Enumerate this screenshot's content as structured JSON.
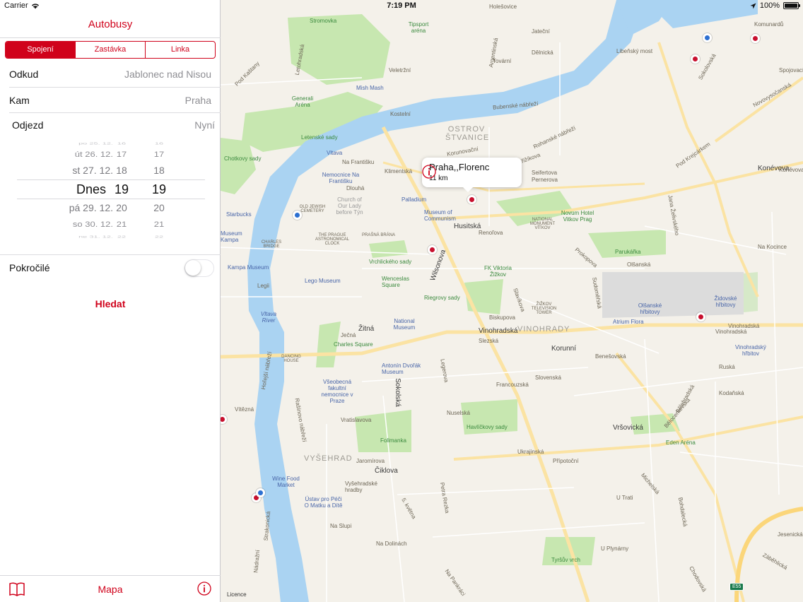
{
  "status": {
    "carrier": "Carrier",
    "time": "7:19 PM",
    "battery": "100%"
  },
  "sidebar": {
    "title": "Autobusy",
    "segments": [
      "Spojení",
      "Zastávka",
      "Linka"
    ],
    "from": {
      "label": "Odkud",
      "value": "Jablonec nad Nisou"
    },
    "to": {
      "label": "Kam",
      "value": "Praha"
    },
    "departure": {
      "label": "Odjezd",
      "value": "Nyní"
    },
    "picker": [
      {
        "day": "po 25. 12.",
        "hour": "16",
        "minute": "16"
      },
      {
        "day": "út 26. 12.",
        "hour": "17",
        "minute": "17"
      },
      {
        "day": "st 27. 12.",
        "hour": "18",
        "minute": "18"
      },
      {
        "day": "Dnes",
        "hour": "19",
        "minute": "19"
      },
      {
        "day": "pá 29. 12.",
        "hour": "20",
        "minute": "20"
      },
      {
        "day": "so 30. 12.",
        "hour": "21",
        "minute": "21"
      },
      {
        "day": "ne 31. 12.",
        "hour": "22",
        "minute": "22"
      }
    ],
    "advanced": {
      "label": "Pokročilé",
      "on": false
    },
    "search_label": "Hledat",
    "tabbar": {
      "left_icon": "book-icon",
      "center": "Mapa",
      "right_icon": "info-icon"
    }
  },
  "map": {
    "callout": {
      "title": "Praha,,Florenc",
      "subtitle": "11 km"
    },
    "legal": "Licence",
    "shield": "E55",
    "labels": [
      {
        "t": "Stromovka",
        "c": "park"
      },
      {
        "t": "Tipsport aréna",
        "c": "park"
      },
      {
        "t": "Generali Aréna",
        "c": "park"
      },
      {
        "t": "Letenské sady",
        "c": "park"
      },
      {
        "t": "Mish Mash",
        "c": "poi"
      },
      {
        "t": "Chotkovy sady",
        "c": "park"
      },
      {
        "t": "Nemocnice Na Františku",
        "c": "poi"
      },
      {
        "t": "Palladium",
        "c": "poi"
      },
      {
        "t": "Museum of Communism",
        "c": "poi"
      },
      {
        "t": "OLD JEWISH CEMETERY",
        "c": ""
      },
      {
        "t": "Church of Our Lady before Týn",
        "c": ""
      },
      {
        "t": "THE PRAGUE ASTRONOMICAL CLOCK",
        "c": ""
      },
      {
        "t": "PRAŠNÁ BRÁNA",
        "c": ""
      },
      {
        "t": "CHARLES BRIDGE",
        "c": ""
      },
      {
        "t": "Starbucks",
        "c": "poi"
      },
      {
        "t": "Museum Kampa",
        "c": "poi"
      },
      {
        "t": "Kampa Museum",
        "c": "poi"
      },
      {
        "t": "Lego Museum",
        "c": "poi"
      },
      {
        "t": "Vrchlického sady",
        "c": "park"
      },
      {
        "t": "Wenceslas Square",
        "c": "park"
      },
      {
        "t": "NATIONAL MONUMENT VÍTKOV",
        "c": ""
      },
      {
        "t": "Novum Hotel Vitkov Prag",
        "c": "park"
      },
      {
        "t": "Parukářka",
        "c": "park"
      },
      {
        "t": "FK Viktoria Žižkov",
        "c": "park"
      },
      {
        "t": "Riegrovy sady",
        "c": "park"
      },
      {
        "t": "ŽIŽKOV TELEVISION TOWER",
        "c": ""
      },
      {
        "t": "Olšanské hřbitovy",
        "c": "poi"
      },
      {
        "t": "Židovské hřbitovy",
        "c": "poi"
      },
      {
        "t": "Atrium Flora",
        "c": "poi"
      },
      {
        "t": "National Museum",
        "c": "poi"
      },
      {
        "t": "Charles Square",
        "c": "park"
      },
      {
        "t": "DANCING HOUSE",
        "c": ""
      },
      {
        "t": "Antonín Dvořák Museum",
        "c": "poi"
      },
      {
        "t": "Všeobecná fakultní nemocnice v Praze",
        "c": "poi"
      },
      {
        "t": "Vinohradský hřbitov",
        "c": "poi"
      },
      {
        "t": "Havlíčkovy sady",
        "c": "park"
      },
      {
        "t": "Folimanka",
        "c": "park"
      },
      {
        "t": "Eden Aréna",
        "c": "park"
      },
      {
        "t": "Vyšehradské hradby",
        "c": ""
      },
      {
        "t": "Wine Food Market",
        "c": "poi"
      },
      {
        "t": "Ústav pro Péči O Matku a Dítě",
        "c": "poi"
      },
      {
        "t": "Tyršův vrch",
        "c": "park"
      },
      {
        "t": "OSTROV ŠTVANICE",
        "c": "dist"
      },
      {
        "t": "VINOHRADY",
        "c": "dist"
      },
      {
        "t": "VYŠEHRAD",
        "c": "dist"
      },
      {
        "t": "Vltava",
        "c": "poi"
      },
      {
        "t": "Vinohradská",
        "c": "big"
      },
      {
        "t": "Žitná",
        "c": "big"
      },
      {
        "t": "Korunní",
        "c": "big"
      },
      {
        "t": "Vršovická",
        "c": "big"
      },
      {
        "t": "Husitská",
        "c": "big"
      },
      {
        "t": "Wilsonova",
        "c": "big"
      },
      {
        "t": "Sokolská",
        "c": "big"
      },
      {
        "t": "Libeňský most",
        "c": "big"
      },
      {
        "t": "Holešovice",
        "c": ""
      },
      {
        "t": "Argentinská",
        "c": ""
      },
      {
        "t": "Dělnická",
        "c": ""
      },
      {
        "t": "Tovární",
        "c": ""
      },
      {
        "t": "Veletržní",
        "c": ""
      },
      {
        "t": "Pod Kaštany",
        "c": ""
      },
      {
        "t": "Bubenské nábřeží",
        "c": ""
      },
      {
        "t": "Rohanské nábřeží",
        "c": ""
      },
      {
        "t": "Konévova",
        "c": "big"
      },
      {
        "t": "Prokopova",
        "c": ""
      },
      {
        "t": "Olšanská",
        "c": ""
      },
      {
        "t": "Slavíkova",
        "c": ""
      },
      {
        "t": "Seifertova",
        "c": ""
      },
      {
        "t": "Koněvova",
        "c": ""
      },
      {
        "t": "Jana Želivského",
        "c": ""
      },
      {
        "t": "Ruská",
        "c": ""
      },
      {
        "t": "Slezská",
        "c": ""
      },
      {
        "t": "Francouzská",
        "c": ""
      },
      {
        "t": "Rašínovo nábřeží",
        "c": ""
      },
      {
        "t": "Vítězná",
        "c": ""
      },
      {
        "t": "Ječná",
        "c": ""
      },
      {
        "t": "Legerova",
        "c": ""
      },
      {
        "t": "Nuselská",
        "c": ""
      },
      {
        "t": "Bělehradská",
        "c": ""
      },
      {
        "t": "Čiklova",
        "c": ""
      },
      {
        "t": "Jaromírova",
        "c": ""
      },
      {
        "t": "Vratislavova",
        "c": ""
      },
      {
        "t": "Na Slupi",
        "c": ""
      },
      {
        "t": "5. května",
        "c": ""
      },
      {
        "t": "Petra Rezka",
        "c": ""
      },
      {
        "t": "U Plynárny",
        "c": ""
      },
      {
        "t": "Záběhlická",
        "c": ""
      },
      {
        "t": "Jesenická",
        "c": ""
      },
      {
        "t": "Bohdalecká",
        "c": ""
      },
      {
        "t": "Chodovská",
        "c": ""
      },
      {
        "t": "Michelská",
        "c": ""
      },
      {
        "t": "Nádražní",
        "c": ""
      },
      {
        "t": "Strakonická",
        "c": ""
      },
      {
        "t": "Hořejší nábřeží",
        "c": ""
      },
      {
        "t": "Pod Krejcárkem",
        "c": ""
      },
      {
        "t": "Spojovací",
        "c": ""
      },
      {
        "t": "Novovysočanská",
        "c": ""
      },
      {
        "t": "Sokolovská",
        "c": ""
      },
      {
        "t": "Kostelní",
        "c": ""
      },
      {
        "t": "Klimentská",
        "c": ""
      },
      {
        "t": "Na Františku",
        "c": ""
      },
      {
        "t": "Dlouhá",
        "c": ""
      },
      {
        "t": "Legii",
        "c": ""
      },
      {
        "t": "Vltava River",
        "c": "poi"
      },
      {
        "t": "Vinohradská",
        "c": ""
      },
      {
        "t": "Biskupova",
        "c": ""
      },
      {
        "t": "Jateční",
        "c": ""
      },
      {
        "t": "Korunovační",
        "c": ""
      },
      {
        "t": "Letohradská",
        "c": ""
      },
      {
        "t": "Pernerova",
        "c": ""
      },
      {
        "t": "Křižíkova",
        "c": ""
      },
      {
        "t": "Renoľova",
        "c": ""
      },
      {
        "t": "Přípotoční",
        "c": ""
      },
      {
        "t": "Kodaňská",
        "c": ""
      },
      {
        "t": "Slovenská",
        "c": ""
      },
      {
        "t": "Benešovská",
        "c": ""
      },
      {
        "t": "Sudoměřská",
        "c": ""
      },
      {
        "t": "Vinohradská",
        "c": ""
      },
      {
        "t": "Ukrajinská",
        "c": ""
      },
      {
        "t": "Na Pankráci",
        "c": ""
      },
      {
        "t": "Na Dolinách",
        "c": ""
      },
      {
        "t": "U Trati",
        "c": ""
      },
      {
        "t": "Bělocerkevská",
        "c": ""
      },
      {
        "t": "Na Kocince",
        "c": ""
      },
      {
        "t": "Komunardů",
        "c": ""
      }
    ]
  },
  "colors": {
    "accent": "#d0021b",
    "park": "#c7e7b0",
    "water": "#aad3f2",
    "road": "#fbe3a3"
  }
}
